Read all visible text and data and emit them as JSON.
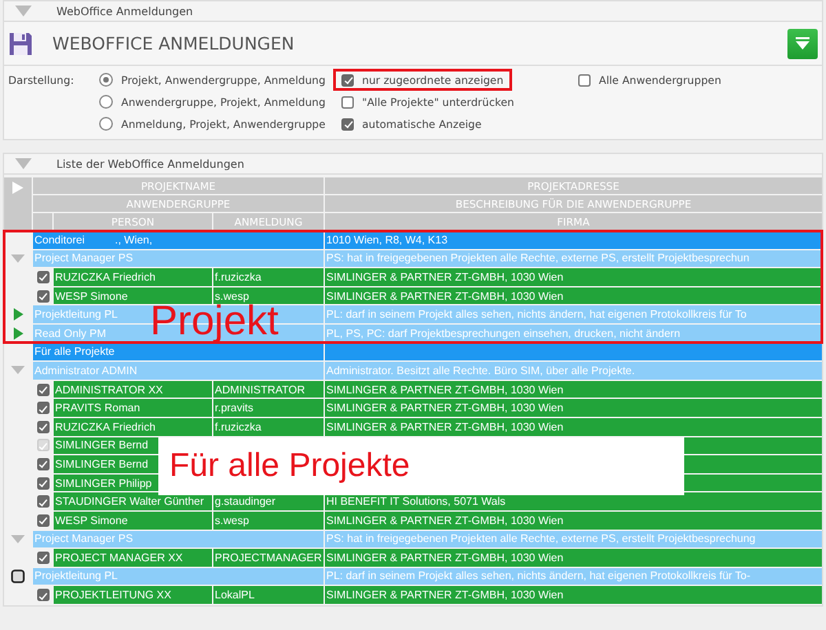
{
  "section_top": {
    "title": "WebOffice Anmeldungen",
    "expanded": true
  },
  "panel": {
    "title": "WEBOFFICE ANMELDUNGEN"
  },
  "options": {
    "label": "Darstellung:",
    "radios": [
      {
        "label": "Projekt, Anwendergruppe, Anmeldung",
        "selected": true
      },
      {
        "label": "Anwendergruppe, Projekt, Anmeldung",
        "selected": false
      },
      {
        "label": "Anmeldung, Projekt, Anwendergruppe",
        "selected": false
      }
    ],
    "checks": [
      {
        "label": "nur zugeordnete anzeigen",
        "checked": true,
        "highlighted": true
      },
      {
        "label": "\"Alle Projekte\" unterdrücken",
        "checked": false
      },
      {
        "label": "automatische Anzeige",
        "checked": true
      }
    ],
    "checks_right": [
      {
        "label": "Alle Anwendergruppen",
        "checked": false
      }
    ]
  },
  "section_list": {
    "title": "Liste der WebOffice Anmeldungen",
    "expanded": true
  },
  "table": {
    "header": {
      "row_1": [
        "PROJEKTNAME",
        "PROJEKTADRESSE"
      ],
      "row_2": [
        "ANWENDERGRUPPE",
        "BESCHREIBUNG FÜR DIE ANWENDERGRUPPE"
      ],
      "row_3": [
        "PERSON",
        "ANMELDUNG",
        "FIRMA"
      ]
    },
    "blocks": [
      {
        "kind": "frame",
        "annotation": "Projekt",
        "rows": [
          {
            "kind": "project",
            "name": "Conditorei",
            "name_2": "., Wien,",
            "detail": "1010 Wien, R8, W4, K13"
          },
          {
            "kind": "group",
            "expanded": true,
            "name": "Project Manager PS",
            "detail": "PS: hat in freigegebenen Projekten alle Rechte, externe PS, erstellt Projektbesprechun"
          },
          {
            "kind": "person",
            "checked": true,
            "disabled": false,
            "name": "RUZICZKA Friedrich",
            "login": "f.ruziczka",
            "detail": "SIMLINGER & PARTNER ZT-GMBH, 1030 Wien"
          },
          {
            "kind": "person",
            "checked": true,
            "disabled": false,
            "name": "WESP Simone",
            "login": "s.wesp",
            "detail": "SIMLINGER & PARTNER ZT-GMBH, 1030 Wien"
          },
          {
            "kind": "group",
            "expanded": false,
            "name": "Projektleitung PL",
            "detail": "PL: darf in seinem Projekt alles sehen, nichts ändern, hat eigenen Protokollkreis für To"
          },
          {
            "kind": "group",
            "expanded": false,
            "name": "Read Only PM",
            "detail": "PL, PS, PC: darf Projektbesprechungen einsehen, drucken, nicht ändern"
          }
        ]
      },
      {
        "kind": "card",
        "annotation": "Für alle Projekte",
        "rows": [
          {
            "kind": "project",
            "name": "Für alle Projekte"
          },
          {
            "kind": "group",
            "expanded": true,
            "name": "Administrator ADMIN",
            "detail": "Administrator. Besitzt alle Rechte. Büro SIM, über alle Projekte."
          },
          {
            "kind": "person",
            "checked": true,
            "disabled": false,
            "name": "ADMINISTRATOR XX",
            "login": "ADMINISTRATOR",
            "detail": "SIMLINGER & PARTNER ZT-GMBH, 1030 Wien"
          },
          {
            "kind": "person",
            "checked": true,
            "disabled": false,
            "name": "PRAVITS Roman",
            "login": "r.pravits",
            "detail": "SIMLINGER & PARTNER ZT-GMBH, 1030 Wien"
          },
          {
            "kind": "person",
            "checked": true,
            "disabled": false,
            "name": "RUZICZKA Friedrich",
            "login": "f.ruziczka",
            "detail": "SIMLINGER & PARTNER ZT-GMBH, 1030 Wien"
          },
          {
            "kind": "person",
            "checked": true,
            "disabled": true,
            "name": "SIMLINGER Bernd"
          },
          {
            "kind": "person",
            "checked": true,
            "disabled": false,
            "name": "SIMLINGER Bernd"
          },
          {
            "kind": "person",
            "checked": true,
            "disabled": false,
            "name": "SIMLINGER Philipp"
          },
          {
            "kind": "person",
            "checked": true,
            "disabled": false,
            "name": "STAUDINGER Walter Günther",
            "login": "g.staudinger",
            "detail": "HI BENEFIT IT Solutions, 5071 Wals"
          },
          {
            "kind": "person",
            "checked": true,
            "disabled": false,
            "name": "WESP Simone",
            "login": "s.wesp",
            "detail": "SIMLINGER & PARTNER ZT-GMBH, 1030 Wien"
          },
          {
            "kind": "group",
            "expanded": true,
            "name": "Project Manager PS",
            "detail": "PS: hat in freigegebenen Projekten alle Rechte, externe PS, erstellt Projektbesprechung"
          },
          {
            "kind": "person",
            "checked": true,
            "disabled": false,
            "name": "PROJECT MANAGER XX",
            "login": "PROJECTMANAGER",
            "detail": "SIMLINGER & PARTNER ZT-GMBH, 1030 Wien"
          },
          {
            "kind": "group_check",
            "checked": false,
            "name": "Projektleitung PL",
            "detail": "PL: darf in seinem Projekt alles sehen, nichts ändern, hat eigenen Protokollkreis für To-"
          },
          {
            "kind": "person",
            "checked": true,
            "disabled": false,
            "name": "PROJEKTLEITUNG XX",
            "login": "LokalPL",
            "detail": "SIMLINGER & PARTNER ZT-GMBH, 1030 Wien"
          }
        ]
      }
    ]
  }
}
